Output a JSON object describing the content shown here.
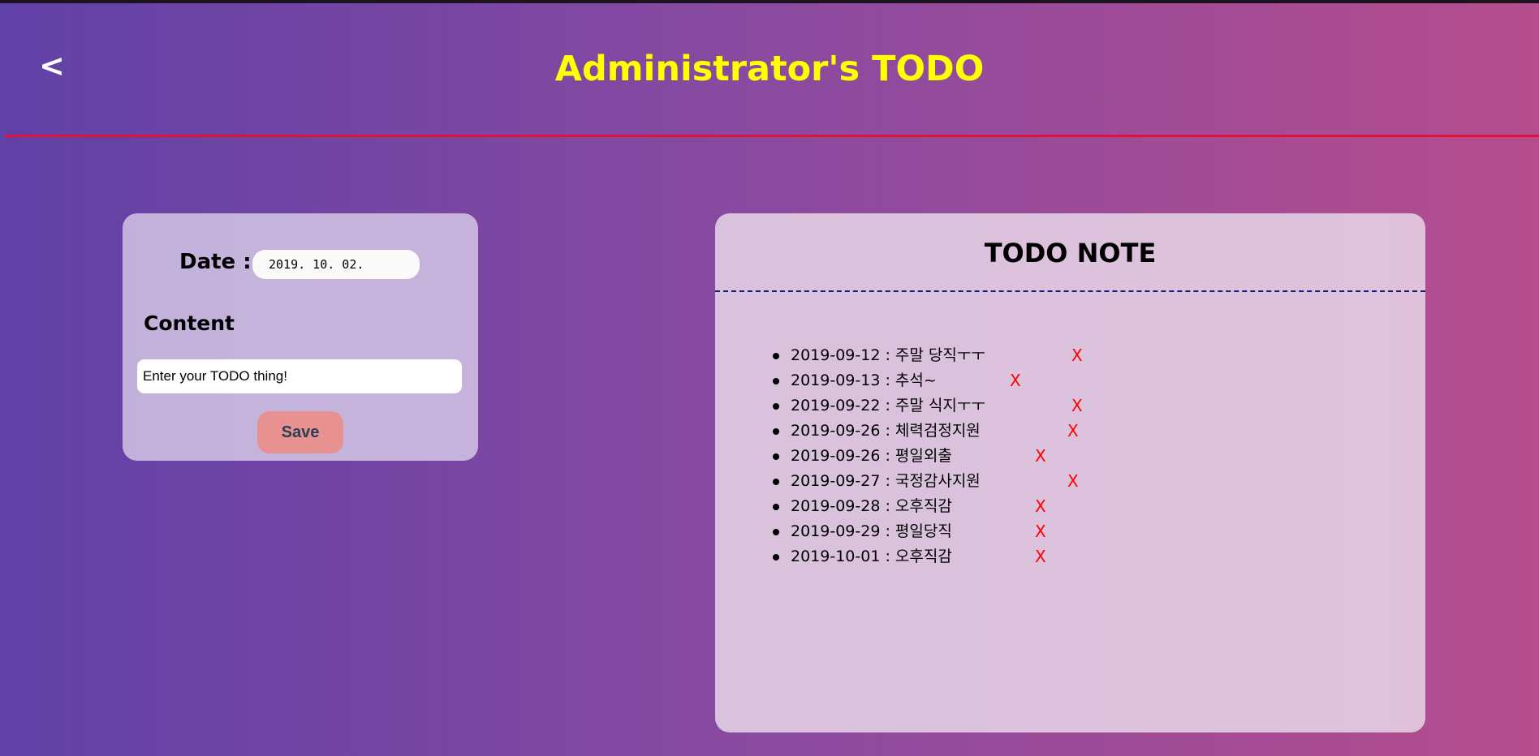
{
  "header": {
    "back_label": "<",
    "title": "Administrator's TODO"
  },
  "form": {
    "date_label": "Date :",
    "date_value": "2019. 10. 02.",
    "content_label": "Content",
    "content_placeholder": "Enter your TODO thing!",
    "save_label": "Save"
  },
  "note": {
    "title": "TODO NOTE",
    "delete_label": "X",
    "items": [
      {
        "text": "2019-09-12 : 주말 당직ㅜㅜ"
      },
      {
        "text": "2019-09-13 : 추석~"
      },
      {
        "text": "2019-09-22 : 주말 식지ㅜㅜ"
      },
      {
        "text": "2019-09-26 : 체력검정지원"
      },
      {
        "text": "2019-09-26 : 평일외출"
      },
      {
        "text": "2019-09-27 : 국정감사지원"
      },
      {
        "text": "2019-09-28 : 오후직감"
      },
      {
        "text": "2019-09-29 : 평일당직"
      },
      {
        "text": "2019-10-01 : 오후직감"
      }
    ]
  },
  "colors": {
    "title": "#ffff00",
    "divider": "#e0123a",
    "delete": "#ff0000",
    "save_button": "#e79290"
  }
}
